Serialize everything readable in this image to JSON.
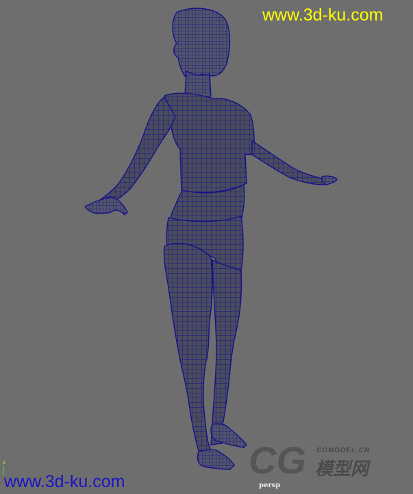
{
  "watermark": {
    "top_text": "www.3d-ku.com",
    "bottom_text": "www.3d-ku.com"
  },
  "viewport": {
    "camera": "persp",
    "axis_label": "z"
  },
  "logo": {
    "cg_small": "CGMODEL.CN",
    "cg_cn": "模型网"
  },
  "colors": {
    "background": "#6e6e6e",
    "wire": "#16128a",
    "wm_top": "#ffff00",
    "wm_bottom": "#1a14c8"
  }
}
